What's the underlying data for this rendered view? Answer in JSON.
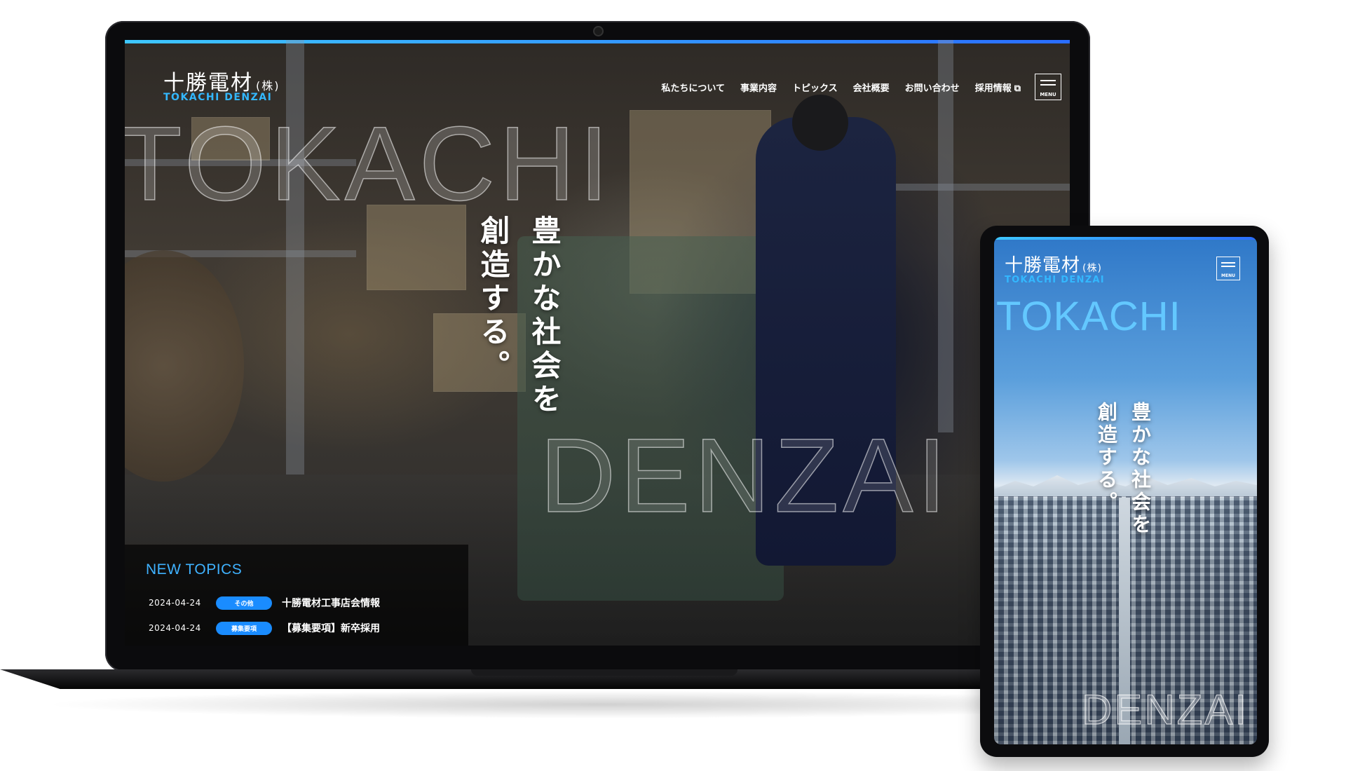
{
  "brand": {
    "name_jp": "十勝電材",
    "suffix": "(株)",
    "name_en": "TOKACHI DENZAI"
  },
  "nav": {
    "items": [
      "私たちについて",
      "事業内容",
      "トピックス",
      "会社概要",
      "お問い合わせ",
      "採用情報"
    ],
    "external_icon": "external-link-icon",
    "menu_label": "MENU"
  },
  "hero": {
    "bg_word_1": "TOKACHI",
    "bg_word_2": "DENZAI",
    "catch_col_1": "豊かな社会を",
    "catch_col_2": "創造する。"
  },
  "topics": {
    "title": "NEW TOPICS",
    "items": [
      {
        "date": "2024-04-24",
        "category": "その他",
        "title": "十勝電材工事店会情報"
      },
      {
        "date": "2024-04-24",
        "category": "募集要項",
        "title": "【募集要項】新卒採用"
      }
    ]
  },
  "colors": {
    "accent": "#33b8ff",
    "badge": "#1a8cff",
    "device_frame": "#0b0b0d"
  }
}
